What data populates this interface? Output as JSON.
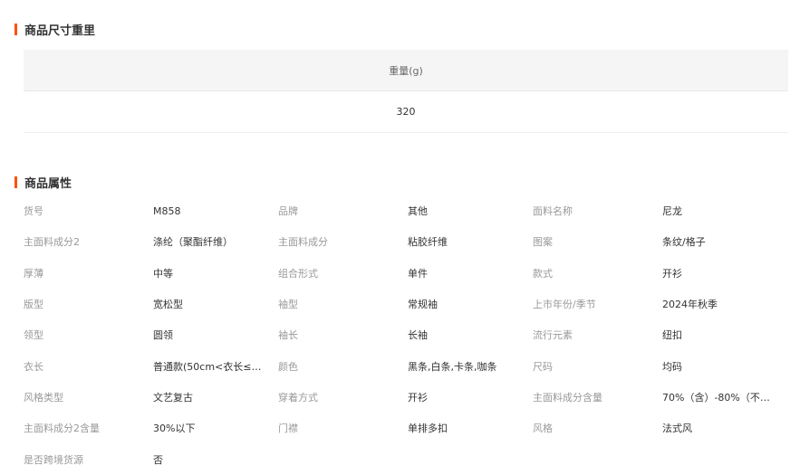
{
  "size_section": {
    "title": "商品尺寸重里",
    "header": "重量(g)",
    "value": "320"
  },
  "attr_section": {
    "title": "商品属性",
    "rows": [
      [
        [
          "货号",
          "M858"
        ],
        [
          "品牌",
          "其他"
        ],
        [
          "面料名称",
          "尼龙"
        ]
      ],
      [
        [
          "主面料成分2",
          "涤纶（聚酯纤维）"
        ],
        [
          "主面料成分",
          "粘胶纤维"
        ],
        [
          "图案",
          "条纹/格子"
        ]
      ],
      [
        [
          "厚薄",
          "中等"
        ],
        [
          "组合形式",
          "单件"
        ],
        [
          "款式",
          "开衫"
        ]
      ],
      [
        [
          "版型",
          "宽松型"
        ],
        [
          "袖型",
          "常规袖"
        ],
        [
          "上市年份/季节",
          "2024年秋季"
        ]
      ],
      [
        [
          "领型",
          "圆领"
        ],
        [
          "袖长",
          "长袖"
        ],
        [
          "流行元素",
          "纽扣"
        ]
      ],
      [
        [
          "衣长",
          "普通款(50cm<衣长≤…"
        ],
        [
          "颜色",
          "黑条,白条,卡条,咖条"
        ],
        [
          "尺码",
          "均码"
        ]
      ],
      [
        [
          "风格类型",
          "文艺复古"
        ],
        [
          "穿着方式",
          "开衫"
        ],
        [
          "主面料成分含量",
          "70%（含）-80%（不…"
        ]
      ],
      [
        [
          "主面料成分2含量",
          "30%以下"
        ],
        [
          "门襟",
          "单排多扣"
        ],
        [
          "风格",
          "法式风"
        ]
      ],
      [
        [
          "是否跨境货源",
          "否"
        ]
      ]
    ]
  }
}
